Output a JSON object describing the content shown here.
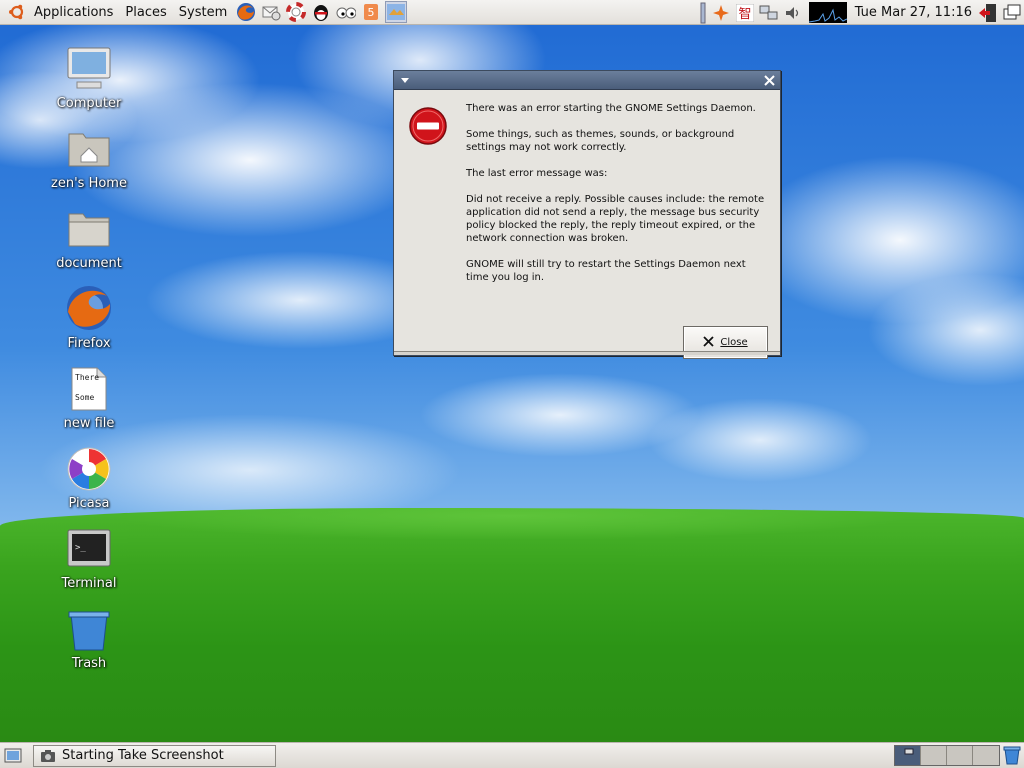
{
  "top_panel": {
    "menus": [
      "Applications",
      "Places",
      "System"
    ],
    "clock": "Tue Mar 27, 11:16"
  },
  "desktop_icons": [
    {
      "label": "Computer"
    },
    {
      "label": "zen's Home"
    },
    {
      "label": "document"
    },
    {
      "label": "Firefox"
    },
    {
      "label": "new file",
      "preview_lines": [
        "There",
        "Some"
      ]
    },
    {
      "label": "Picasa"
    },
    {
      "label": "Terminal"
    },
    {
      "label": "Trash"
    }
  ],
  "dialog": {
    "primary": "There was an error starting the GNOME Settings Daemon.",
    "secondary": "Some things, such as themes, sounds, or background settings may not work correctly.",
    "last_error_label": "The last error message was:",
    "error_detail": "Did not receive a reply. Possible causes include: the remote application did not send a reply, the message bus security policy blocked the reply, the reply timeout expired, or the network connection was broken.",
    "restart_note": "GNOME will still try to restart the Settings Daemon next time you log in.",
    "close_label": "Close"
  },
  "taskbar": {
    "task_label": "Starting Take Screenshot"
  },
  "colors": {
    "panel_bg": "#e3e0db",
    "titlebar": "#4a5d7a",
    "dialog_bg": "#e6e4df",
    "error_red": "#d0141b"
  }
}
